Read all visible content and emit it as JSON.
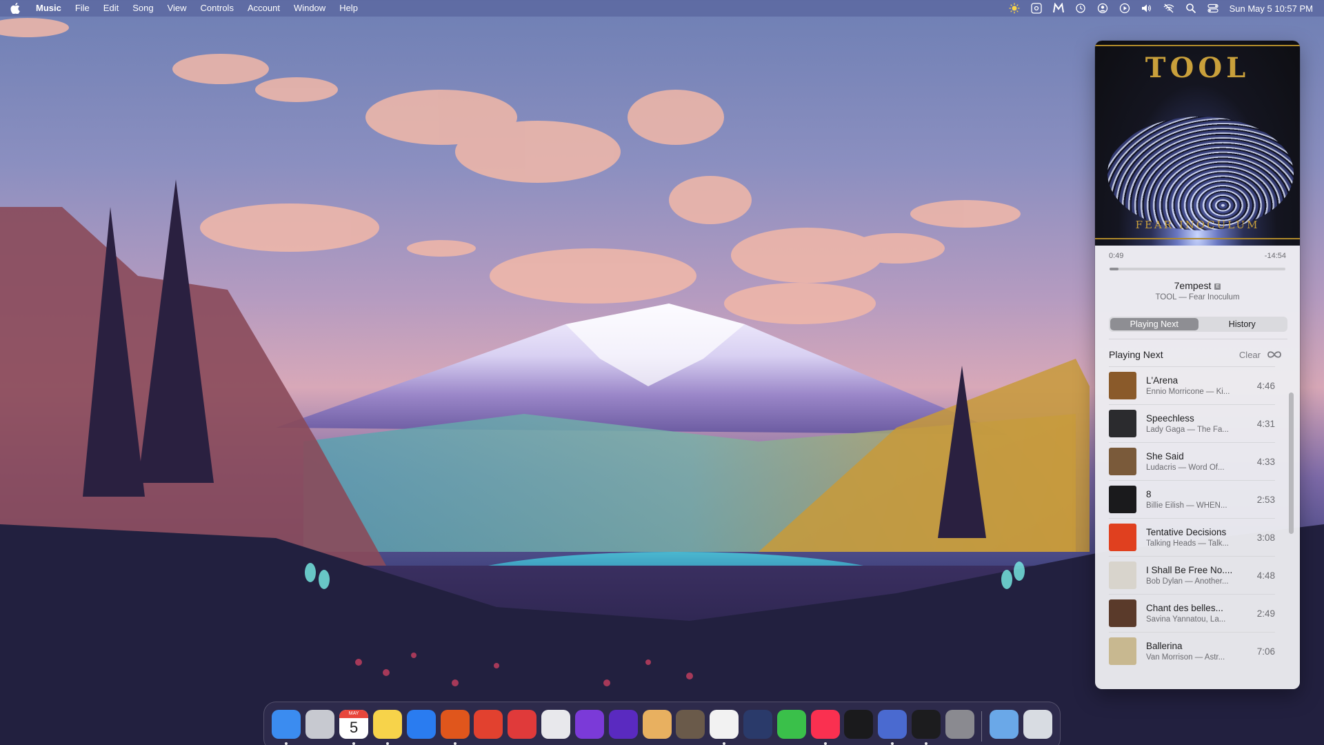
{
  "menubar": {
    "app_name": "Music",
    "menus": [
      "File",
      "Edit",
      "Song",
      "View",
      "Controls",
      "Account",
      "Window",
      "Help"
    ],
    "status_icons": [
      "sun-icon",
      "gear-box-icon",
      "m-logo-icon",
      "time-machine-icon",
      "user-circle-icon",
      "play-circle-icon",
      "volume-icon",
      "wifi-off-icon",
      "search-icon",
      "control-center-icon"
    ],
    "clock": "Sun May 5  10:57 PM"
  },
  "now_playing": {
    "elapsed": "0:49",
    "remaining": "-14:54",
    "progress_fraction": 0.052,
    "title": "7empest",
    "explicit_badge": "E",
    "subtitle": "TOOL — Fear Inoculum",
    "artwork": {
      "top_text": "TOOL",
      "bottom_text": "FEAR INOCULUM"
    }
  },
  "tabs": [
    {
      "label": "Playing Next",
      "active": true
    },
    {
      "label": "History",
      "active": false
    }
  ],
  "queue": {
    "heading": "Playing Next",
    "clear_label": "Clear",
    "items": [
      {
        "title": "L'Arena",
        "subtitle": "Ennio Morricone — Ki...",
        "duration": "4:46",
        "color": "#8a5a2a"
      },
      {
        "title": "Speechless",
        "subtitle": "Lady Gaga — The Fa...",
        "duration": "4:31",
        "color": "#2b2b2e"
      },
      {
        "title": "She Said",
        "subtitle": "Ludacris — Word Of...",
        "duration": "4:33",
        "color": "#7a5a3a"
      },
      {
        "title": "8",
        "subtitle": "Billie Eilish — WHEN...",
        "duration": "2:53",
        "color": "#1a1a1c"
      },
      {
        "title": "Tentative Decisions",
        "subtitle": "Talking Heads — Talk...",
        "duration": "3:08",
        "color": "#e0401f"
      },
      {
        "title": "I Shall Be Free No....",
        "subtitle": "Bob Dylan — Another...",
        "duration": "4:48",
        "color": "#d8d4cc"
      },
      {
        "title": "Chant des belles...",
        "subtitle": "Savina Yannatou, La...",
        "duration": "2:49",
        "color": "#5a3a2a"
      },
      {
        "title": "Ballerina",
        "subtitle": "Van Morrison — Astr...",
        "duration": "7:06",
        "color": "#c8b890"
      }
    ]
  },
  "dock": {
    "calendar_month": "MAY",
    "calendar_day": "5",
    "items": [
      {
        "name": "finder",
        "color": "#3b8cf0",
        "running": true
      },
      {
        "name": "launchpad",
        "color": "#c7c9d0",
        "running": false
      },
      {
        "name": "calendar",
        "color": "#ffffff",
        "running": true
      },
      {
        "name": "notes",
        "color": "#f7d34a",
        "running": true
      },
      {
        "name": "safari",
        "color": "#2a7cf0",
        "running": false
      },
      {
        "name": "firefox",
        "color": "#e0561c",
        "running": true
      },
      {
        "name": "pdf-expert",
        "color": "#e2412f",
        "running": false
      },
      {
        "name": "printer",
        "color": "#e03a3a",
        "running": false
      },
      {
        "name": "preview",
        "color": "#e8e8ec",
        "running": false
      },
      {
        "name": "affinity-photo",
        "color": "#7b3ad8",
        "running": false
      },
      {
        "name": "affinity-designer",
        "color": "#5a2ac0",
        "running": false
      },
      {
        "name": "pixelmator",
        "color": "#e8b060",
        "running": false
      },
      {
        "name": "gimp",
        "color": "#6a5a4a",
        "running": false
      },
      {
        "name": "photos",
        "color": "#f2f2f2",
        "running": true
      },
      {
        "name": "layers-app",
        "color": "#2a3a6a",
        "running": false
      },
      {
        "name": "facetime",
        "color": "#3ac04a",
        "running": false
      },
      {
        "name": "music",
        "color": "#fa3050",
        "running": true
      },
      {
        "name": "apple-tv",
        "color": "#1a1a1c",
        "running": false
      },
      {
        "name": "sun-utility",
        "color": "#4a6ad0",
        "running": true
      },
      {
        "name": "terminal",
        "color": "#1c1c1e",
        "running": true
      },
      {
        "name": "system-settings",
        "color": "#8a8a90",
        "running": false
      }
    ],
    "right_items": [
      {
        "name": "downloads",
        "color": "#6aa8e8"
      },
      {
        "name": "trash",
        "color": "#d8dce2"
      }
    ]
  }
}
